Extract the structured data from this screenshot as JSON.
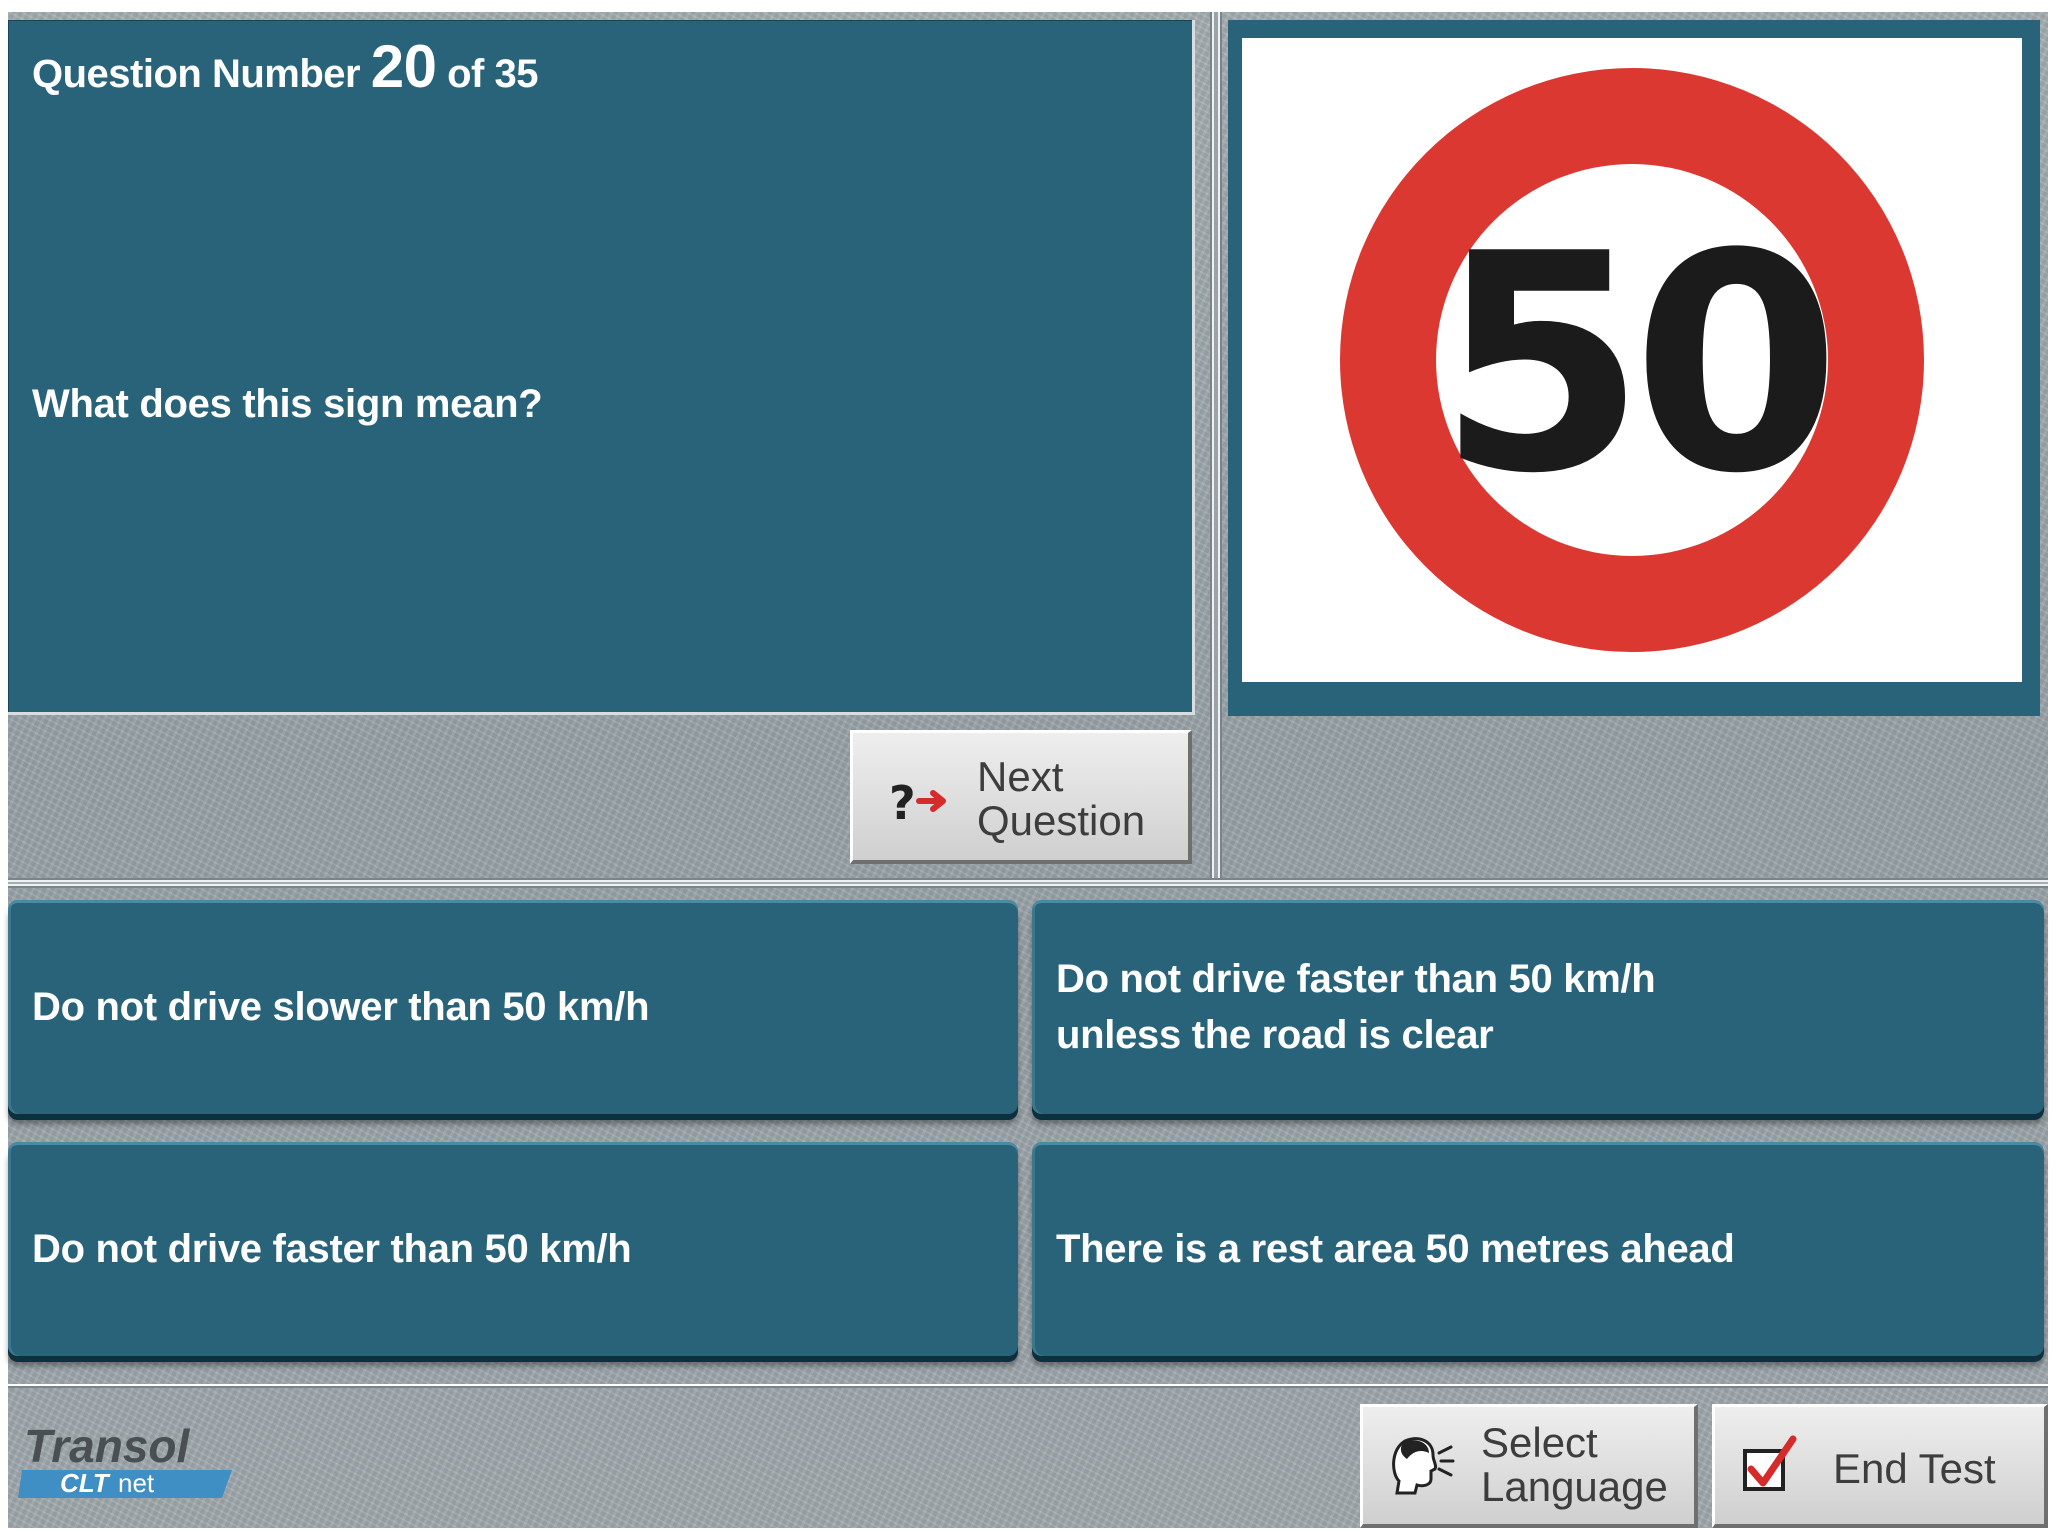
{
  "question": {
    "prefix": "Question Number",
    "number": "20",
    "of_label": "of 35",
    "text": "What does this sign mean?"
  },
  "sign": {
    "value": "50",
    "ring_color": "#db3832",
    "digit_color": "#1b1b1b"
  },
  "next_button": {
    "line1": "Next",
    "line2": "Question",
    "icon": "question-arrow-icon"
  },
  "answers": [
    {
      "lines": [
        "Do not drive slower than 50 km/h"
      ]
    },
    {
      "lines": [
        "Do not drive faster than 50 km/h",
        "unless the road is clear"
      ]
    },
    {
      "lines": [
        "Do not drive faster than 50 km/h"
      ]
    },
    {
      "lines": [
        "There is a rest area 50 metres ahead"
      ]
    }
  ],
  "footer": {
    "logo_text": "Transol",
    "logo_sub_bold": "CLT",
    "logo_sub_light": "net",
    "select_language": {
      "line1": "Select",
      "line2": "Language",
      "icon": "speaking-head-icon"
    },
    "end_test": {
      "label": "End Test",
      "icon": "checkbox-checked-icon"
    }
  },
  "colors": {
    "panel": "#29637a",
    "button_face": "#dcdcdc"
  }
}
